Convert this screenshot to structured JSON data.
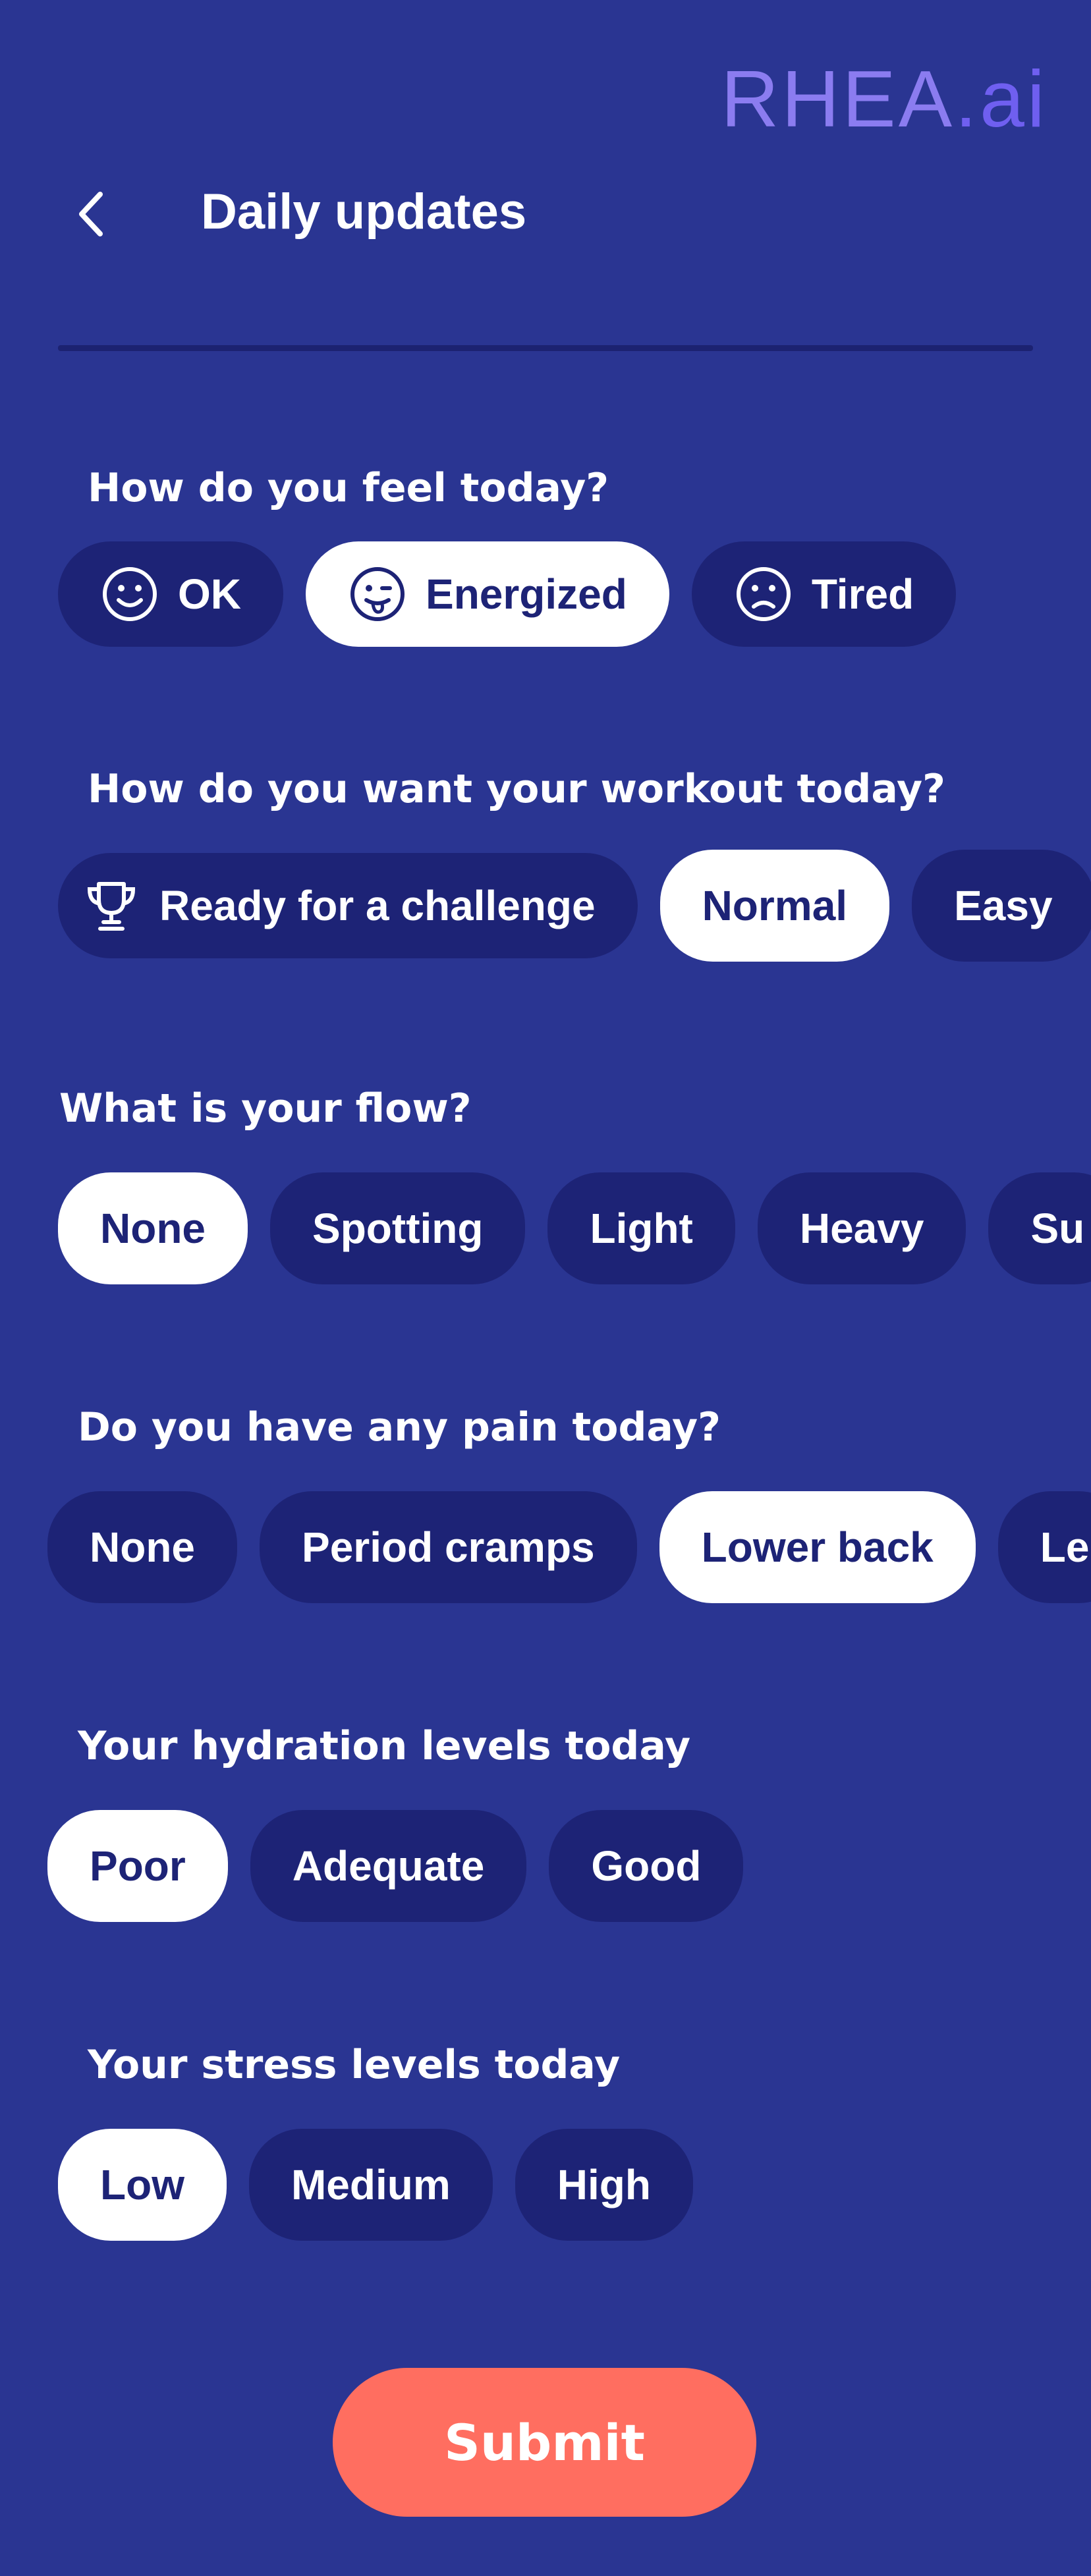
{
  "brand": {
    "logo_text": "RHEA",
    "logo_ai": ".ai",
    "accent": "#8b7cf0"
  },
  "header": {
    "title": "Daily updates"
  },
  "colors": {
    "background": "#2a3592",
    "chip": "#1d2376",
    "chip_selected": "#ffffff",
    "submit": "#ff6e60"
  },
  "feel": {
    "question": "How do you feel today?",
    "options": [
      {
        "label": "OK",
        "icon": "smile-icon",
        "selected": false
      },
      {
        "label": "Energized",
        "icon": "tongue-face-icon",
        "selected": true
      },
      {
        "label": "Tired",
        "icon": "frown-icon",
        "selected": false
      }
    ]
  },
  "workout": {
    "question": "How do you want your workout today?",
    "options": [
      {
        "label": "Ready for a challenge",
        "icon": "trophy-icon",
        "selected": false
      },
      {
        "label": "Normal",
        "selected": true
      },
      {
        "label": "Easy",
        "selected": false
      }
    ]
  },
  "flow": {
    "question": "What is your flow?",
    "options": [
      {
        "label": "None",
        "selected": true
      },
      {
        "label": "Spotting",
        "selected": false
      },
      {
        "label": "Light",
        "selected": false
      },
      {
        "label": "Heavy",
        "selected": false
      },
      {
        "label": "Su",
        "selected": false
      }
    ]
  },
  "pain": {
    "question": "Do you have any pain today?",
    "options": [
      {
        "label": "None",
        "selected": false
      },
      {
        "label": "Period cramps",
        "selected": false
      },
      {
        "label": "Lower back",
        "selected": true
      },
      {
        "label": "Le",
        "selected": false
      }
    ]
  },
  "hydration": {
    "question": "Your hydration levels today",
    "options": [
      {
        "label": "Poor",
        "selected": true
      },
      {
        "label": "Adequate",
        "selected": false
      },
      {
        "label": "Good",
        "selected": false
      }
    ]
  },
  "stress": {
    "question": "Your stress levels today",
    "options": [
      {
        "label": "Low",
        "selected": true
      },
      {
        "label": "Medium",
        "selected": false
      },
      {
        "label": "High",
        "selected": false
      }
    ]
  },
  "submit_label": "Submit"
}
